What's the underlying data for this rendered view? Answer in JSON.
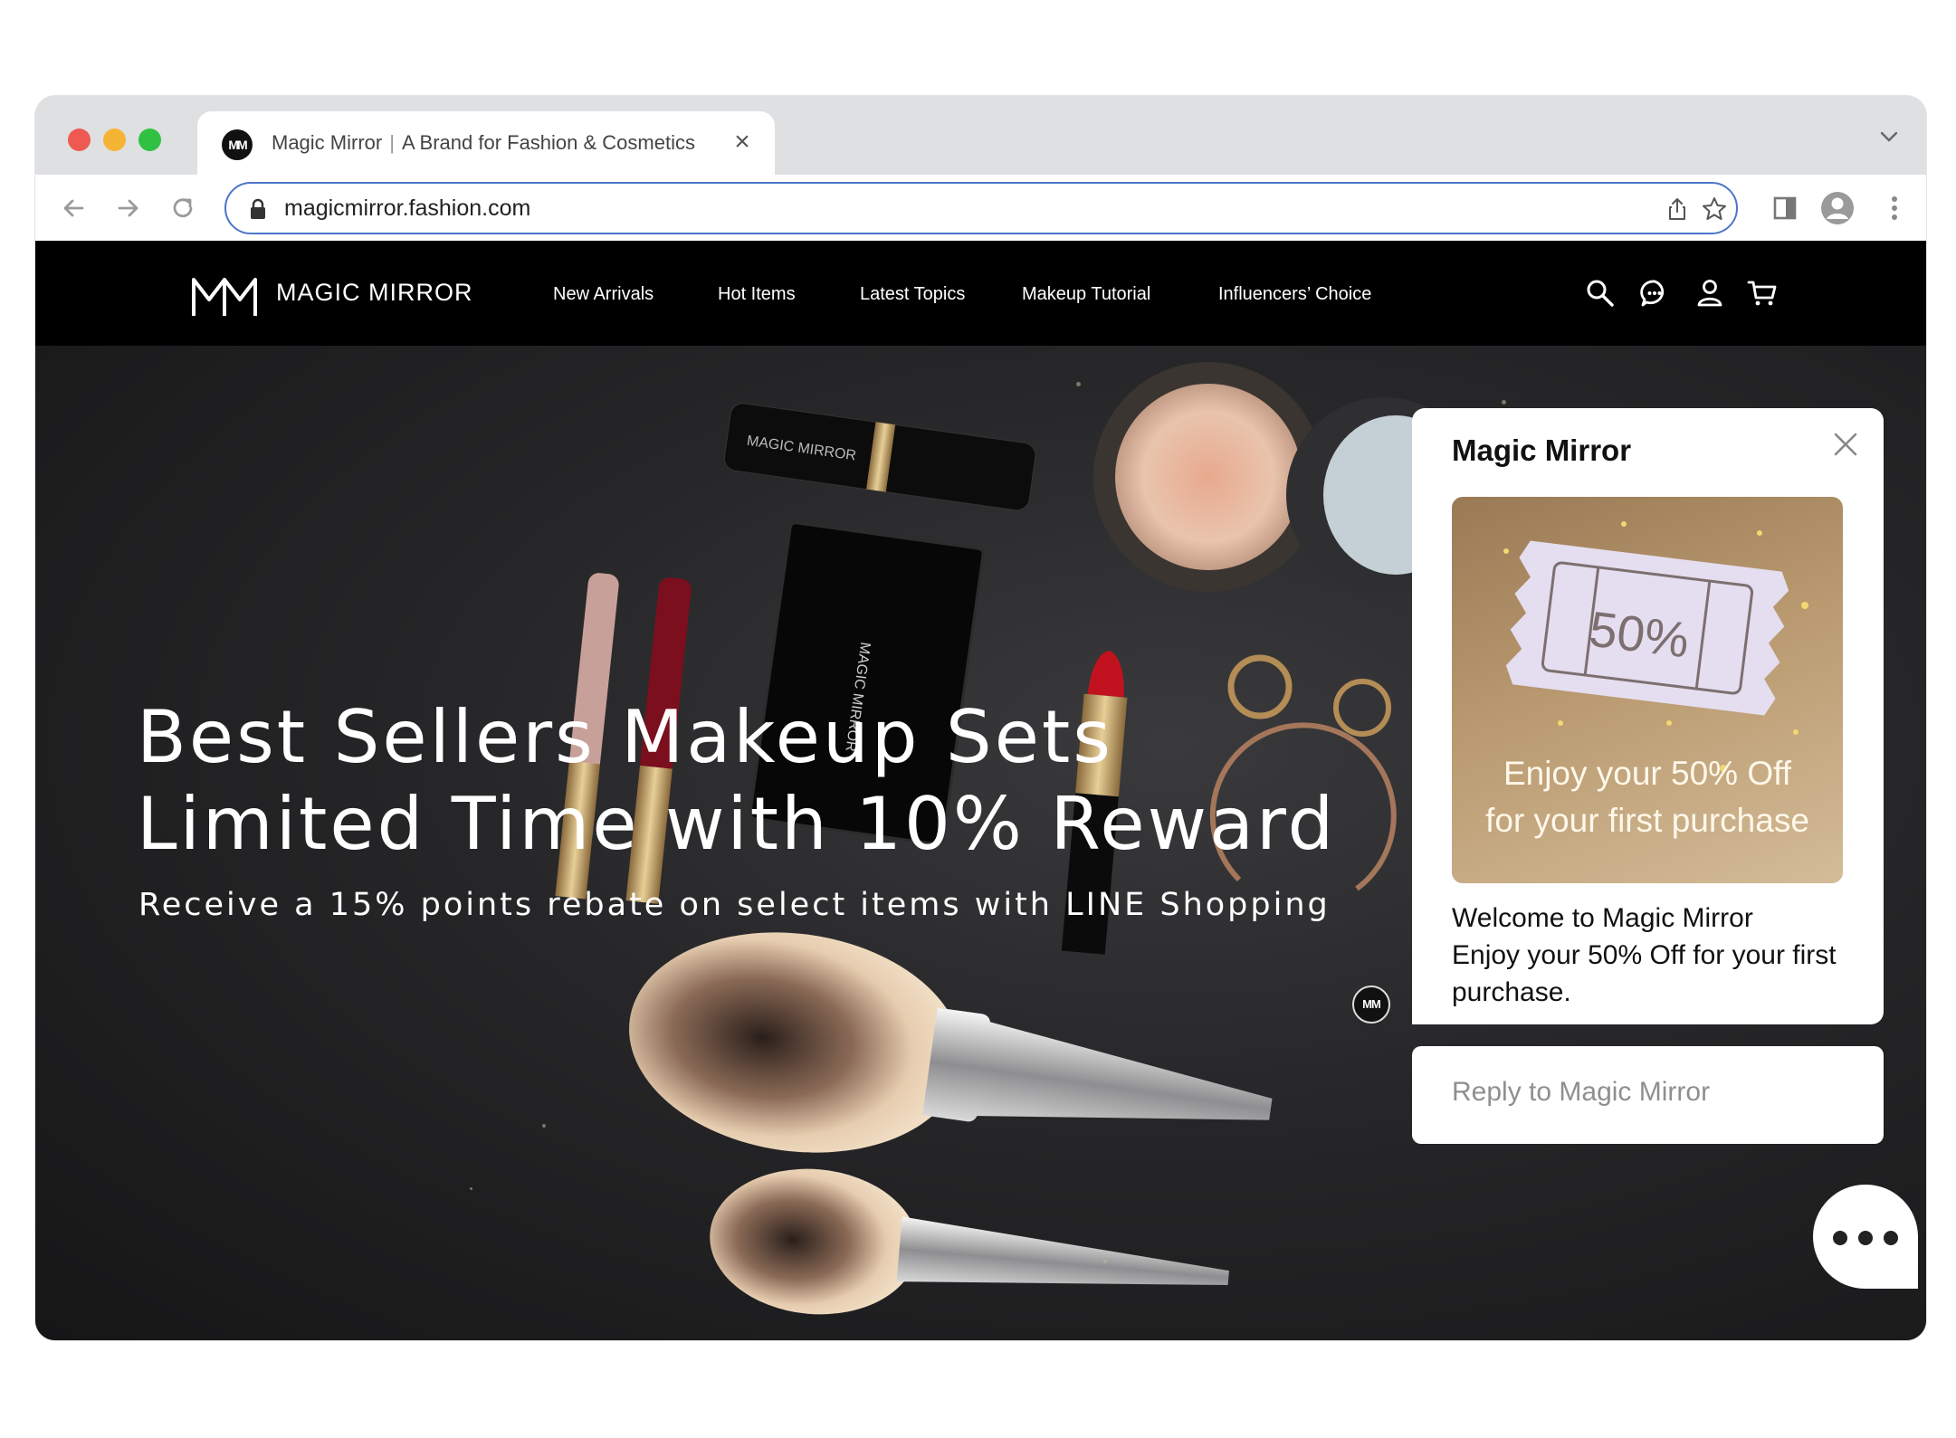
{
  "browser": {
    "tab": {
      "favicon": "MM",
      "title_primary": "Magic Mirror",
      "title_separator": "|",
      "title_secondary": "A Brand for Fashion & Cosmetics",
      "close_glyph": "×"
    },
    "url": "magicmirror.fashion.com",
    "icons": [
      "back-icon",
      "forward-icon",
      "reload-icon",
      "lock-icon",
      "share-icon",
      "star-icon",
      "sidepanel-icon",
      "profile-icon",
      "menu-icon",
      "tab-list-chevron-icon"
    ]
  },
  "site": {
    "logo_text": "MAGIC MIRROR",
    "menu": [
      {
        "label": "New Arrivals"
      },
      {
        "label": "Hot Items"
      },
      {
        "label": "Latest Topics"
      },
      {
        "label": "Makeup Tutorial"
      },
      {
        "label": "Influencers’ Choice"
      }
    ],
    "header_icons": [
      "search-icon",
      "chat-icon",
      "account-icon",
      "cart-icon"
    ]
  },
  "hero": {
    "title_line1": "Best Sellers Makeup Sets",
    "title_line2": "Limited Time with 10% Reward",
    "subtitle": "Receive a 15% points rebate on select items with LINE Shopping"
  },
  "chat": {
    "avatar": "MM",
    "title": "Magic Mirror",
    "promo": {
      "coupon": "50%",
      "line1": "Enjoy your 50% Off",
      "line2": "for your first purchase"
    },
    "message_line1": "Welcome to Magic Mirror",
    "message_line2": "Enjoy your 50% Off for your first purchase.",
    "reply_placeholder": "Reply to Magic Mirror"
  },
  "colors": {
    "accent_focus": "#4c76c8",
    "nav_bg": "#000000",
    "hero_bg": "#262628",
    "promo_gold": "#b9996f",
    "coupon": "#e5def0"
  }
}
